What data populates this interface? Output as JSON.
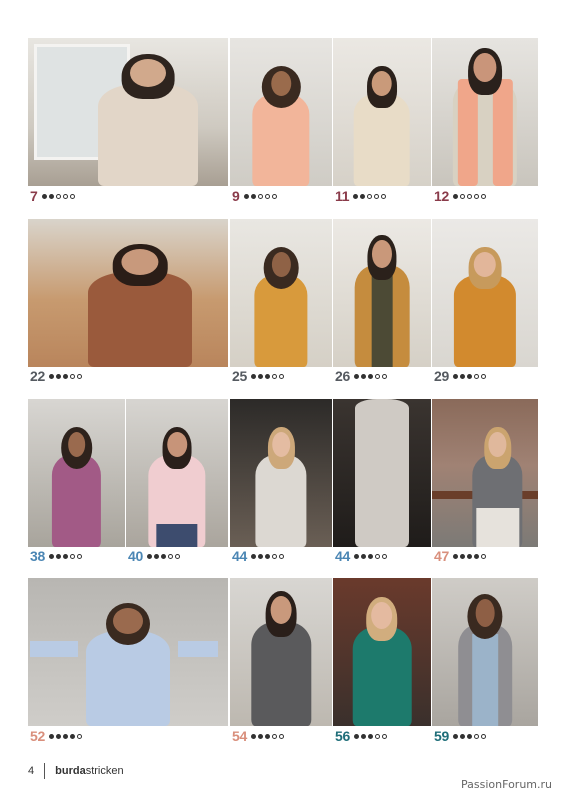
{
  "page_number": "4",
  "brand": {
    "bold": "burda",
    "regular": "stricken"
  },
  "watermark": "PassionForum.ru",
  "colors": {
    "maroon": "#8a3b4a",
    "brown": "#4a3b32",
    "gray": "#555a60",
    "blue": "#4b86b4",
    "salmon": "#d98f7c",
    "teal": "#1f6e79"
  },
  "items": [
    {
      "num": "7",
      "level": 2,
      "color": "maroon"
    },
    {
      "num": "9",
      "level": 2,
      "color": "maroon"
    },
    {
      "num": "11",
      "level": 2,
      "color": "maroon"
    },
    {
      "num": "12",
      "level": 1,
      "color": "maroon"
    },
    {
      "num": "22",
      "level": 3,
      "color": "gray"
    },
    {
      "num": "25",
      "level": 3,
      "color": "gray"
    },
    {
      "num": "26",
      "level": 3,
      "color": "gray"
    },
    {
      "num": "29",
      "level": 3,
      "color": "gray"
    },
    {
      "num": "38",
      "level": 3,
      "color": "blue"
    },
    {
      "num": "40",
      "level": 3,
      "color": "blue"
    },
    {
      "num": "44",
      "level": 3,
      "color": "blue"
    },
    {
      "num": "44",
      "level": 3,
      "color": "blue"
    },
    {
      "num": "47",
      "level": 4,
      "color": "salmon"
    },
    {
      "num": "52",
      "level": 4,
      "color": "salmon"
    },
    {
      "num": "54",
      "level": 3,
      "color": "salmon"
    },
    {
      "num": "56",
      "level": 3,
      "color": "teal"
    },
    {
      "num": "59",
      "level": 3,
      "color": "teal"
    }
  ]
}
